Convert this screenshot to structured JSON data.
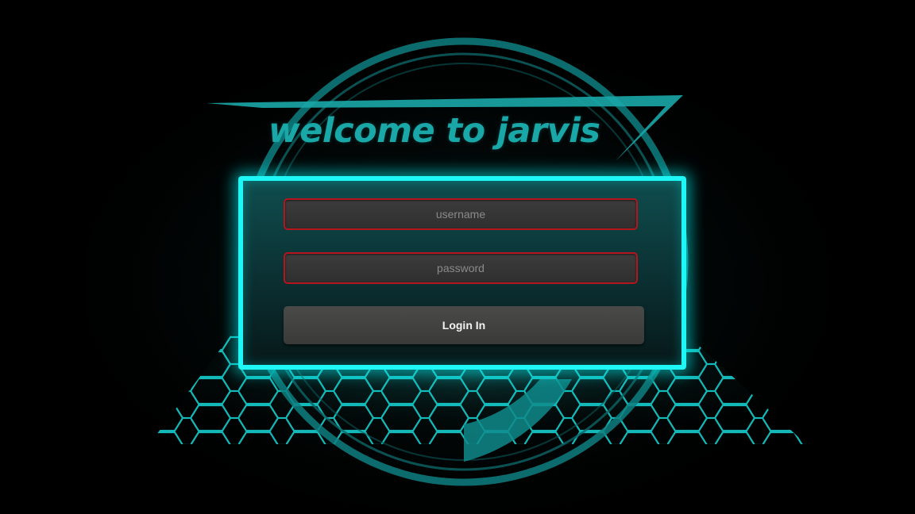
{
  "page": {
    "title": "welcome to jarvis"
  },
  "login_form": {
    "username_placeholder": "username",
    "password_placeholder": "password",
    "login_label": "Login In"
  },
  "colors": {
    "background": "#000000",
    "accent_cyan": "#1ff6f6",
    "title_teal": "#1aa7a7",
    "field_border_red": "#b5151c",
    "field_fill": "#333333",
    "button_fill": "#424240"
  }
}
